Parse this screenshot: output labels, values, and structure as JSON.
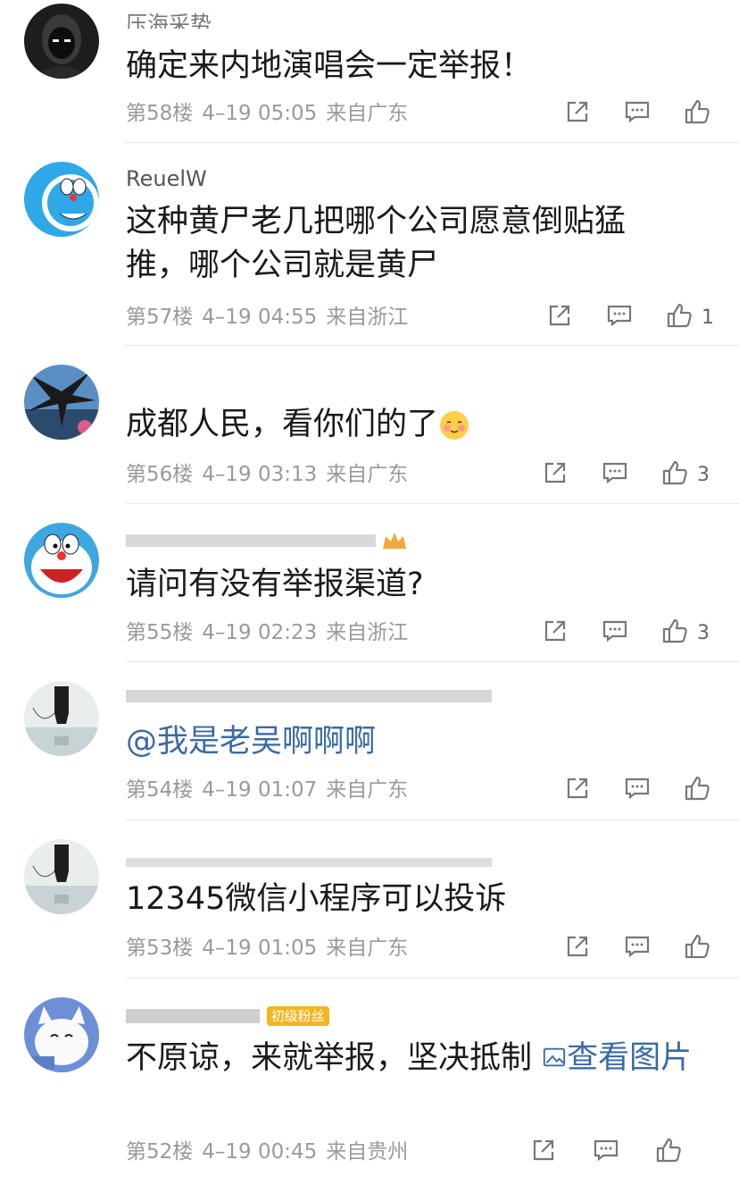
{
  "comments": [
    {
      "username": "压海采势",
      "text": "确定来内地演唱会一定举报！",
      "floor": "第58楼",
      "time": "4–19 05:05",
      "location": "来自广东",
      "likes": ""
    },
    {
      "username": "ReuelW",
      "text": "这种黄尸老几把哪个公司愿意倒贴猛推，哪个公司就是黄尸",
      "floor": "第57楼",
      "time": "4–19 04:55",
      "location": "来自浙江",
      "likes": "1"
    },
    {
      "username": "",
      "text": "成都人民，看你们的了",
      "floor": "第56楼",
      "time": "4–19 03:13",
      "location": "来自广东",
      "likes": "3"
    },
    {
      "username": "",
      "text": "请问有没有举报渠道?",
      "floor": "第55楼",
      "time": "4–19 02:23",
      "location": "来自浙江",
      "likes": "3"
    },
    {
      "username": "",
      "mention": "@我是老吴啊啊啊",
      "floor": "第54楼",
      "time": "4–19 01:07",
      "location": "来自广东",
      "likes": ""
    },
    {
      "username": "",
      "text": "12345微信小程序可以投诉",
      "floor": "第53楼",
      "time": "4–19 01:05",
      "location": "来自广东",
      "likes": ""
    },
    {
      "username": "",
      "badge": "初级粉丝",
      "text": "不原谅，来就举报，坚决抵制",
      "view_image": "查看图片",
      "floor": "第52楼",
      "time": "4–19 00:45",
      "location": "来自贵州",
      "likes": ""
    }
  ],
  "icons": {
    "share": "share-icon",
    "comment": "comment-icon",
    "like": "thumbs-up-icon",
    "image": "image-icon"
  },
  "colors": {
    "link": "#3b6aa3",
    "meta": "#9a9a9a",
    "text": "#1a1a1a"
  }
}
